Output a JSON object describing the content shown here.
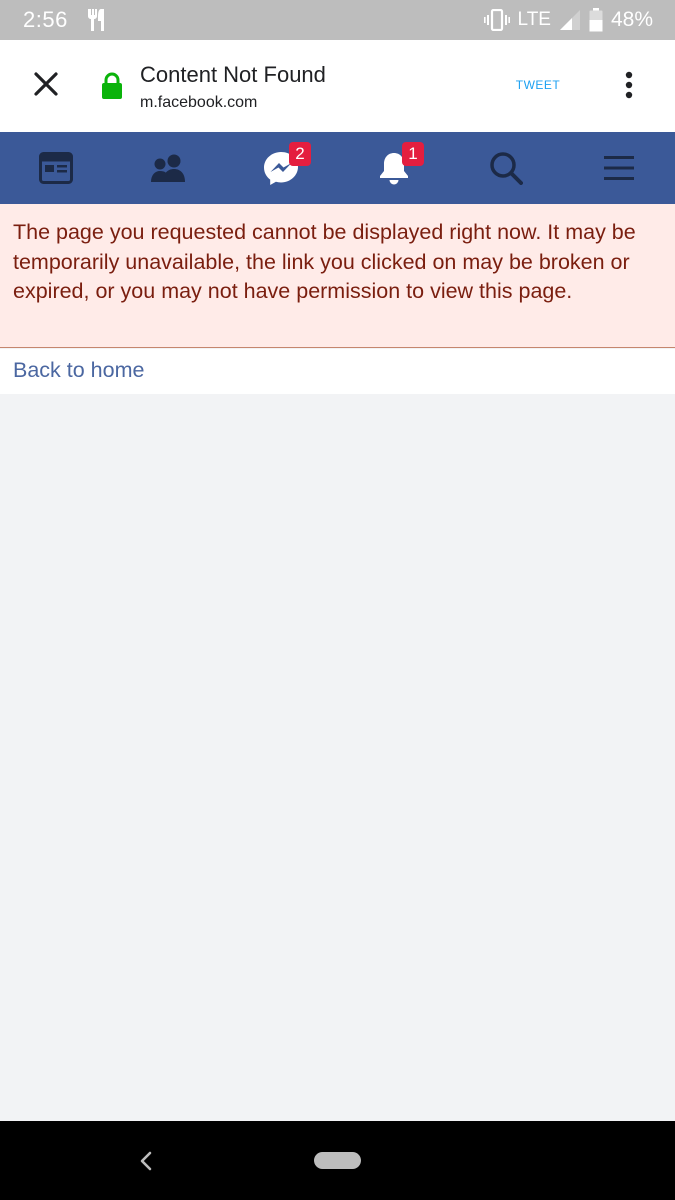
{
  "status_bar": {
    "time": "2:56",
    "network": "LTE",
    "battery": "48%"
  },
  "tab": {
    "title": "Content Not Found",
    "url": "m.facebook.com",
    "tweet_label": "TWEET"
  },
  "nav": {
    "items": [
      {
        "icon": "news-feed-icon"
      },
      {
        "icon": "friends-icon"
      },
      {
        "icon": "messenger-icon",
        "badge": "2"
      },
      {
        "icon": "notifications-icon",
        "badge": "1"
      },
      {
        "icon": "search-icon"
      },
      {
        "icon": "menu-icon"
      }
    ]
  },
  "error": {
    "message": "The page you requested cannot be displayed right now. It may be temporarily unavailable, the link you clicked on may be broken or expired, or you may not have permission to view this page."
  },
  "back_link": "Back to home",
  "colors": {
    "facebook_blue": "#3b5998",
    "error_bg": "#ffebe8",
    "error_text": "#7a1e0f",
    "link": "#4b67a1",
    "lock_green": "#0ab30a"
  }
}
